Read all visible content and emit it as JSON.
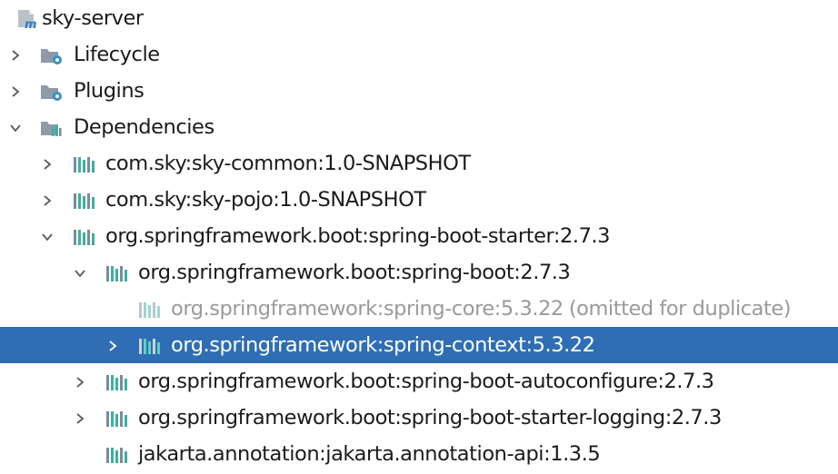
{
  "tree": {
    "root": {
      "label": "sky-server",
      "icon": "maven-module-icon"
    },
    "nodes": [
      {
        "label": "Lifecycle",
        "icon": "lifecycle-folder-icon",
        "expanded": false
      },
      {
        "label": "Plugins",
        "icon": "plugins-folder-icon",
        "expanded": false
      },
      {
        "label": "Dependencies",
        "icon": "dependencies-folder-icon",
        "expanded": true
      },
      {
        "label": "com.sky:sky-common:1.0-SNAPSHOT",
        "icon": "library-icon",
        "expanded": false
      },
      {
        "label": "com.sky:sky-pojo:1.0-SNAPSHOT",
        "icon": "library-icon",
        "expanded": false
      },
      {
        "label": "org.springframework.boot:spring-boot-starter:2.7.3",
        "icon": "library-icon",
        "expanded": true
      },
      {
        "label": "org.springframework.boot:spring-boot:2.7.3",
        "icon": "library-icon",
        "expanded": true
      },
      {
        "label": "org.springframework:spring-core:5.3.22",
        "suffix": "(omitted for duplicate)",
        "icon": "library-icon",
        "omitted": true
      },
      {
        "label": "org.springframework:spring-context:5.3.22",
        "icon": "library-icon",
        "expanded": false,
        "selected": true
      },
      {
        "label": "org.springframework.boot:spring-boot-autoconfigure:2.7.3",
        "icon": "library-icon",
        "expanded": false
      },
      {
        "label": "org.springframework.boot:spring-boot-starter-logging:2.7.3",
        "icon": "library-icon",
        "expanded": false
      },
      {
        "label": "jakarta.annotation:jakarta.annotation-api:1.3.5",
        "icon": "library-icon"
      }
    ]
  },
  "colors": {
    "selection": "#2f6eb5",
    "text": "#1b1b1b",
    "omitted_text": "#9a9a9a",
    "chevron": "#5a5a5a",
    "folder": "#8f9aa6",
    "gear": "#3592c4",
    "lib_teal": "#3bb0a0",
    "lib_grey": "#7d8b96"
  }
}
